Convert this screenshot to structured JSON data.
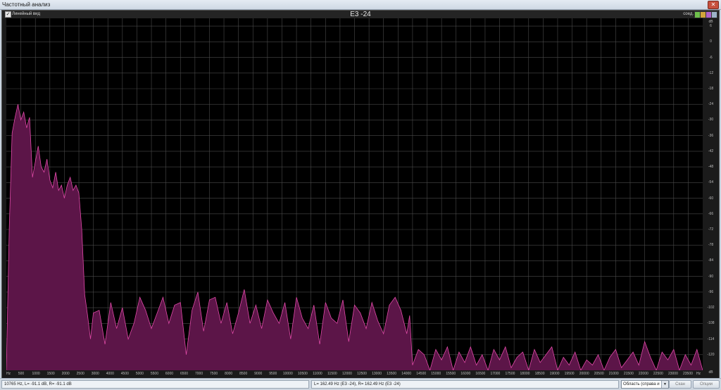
{
  "window": {
    "title": "Частотный анализ",
    "close_glyph": "✕"
  },
  "toolbar": {
    "checkbox_label": "Линейный вид",
    "checkbox_checked": true,
    "check_glyph": "✓",
    "title": "E3 -24",
    "right_label": "соед."
  },
  "colors": {
    "spectrum_fill": "#5c1548",
    "spectrum_stroke": "#e04aa8",
    "grid": "#4a4a4a",
    "accent_buttons": [
      "#6fbf4b",
      "#d1a53a",
      "#b061c8",
      "#9cb2c8"
    ]
  },
  "y_axis": {
    "unit_top": "dB",
    "unit_bottom": "dB",
    "ticks": [
      "6",
      "0",
      "-6",
      "-12",
      "-18",
      "-24",
      "-30",
      "-36",
      "-42",
      "-48",
      "-54",
      "-60",
      "-66",
      "-72",
      "-78",
      "-84",
      "-90",
      "-96",
      "-102",
      "-108",
      "-114",
      "-120"
    ]
  },
  "x_axis": {
    "left_label": "Hz",
    "right_label": "Hz",
    "ticks": [
      "500",
      "1000",
      "1500",
      "2000",
      "2500",
      "3000",
      "4000",
      "4500",
      "5000",
      "5500",
      "6000",
      "6500",
      "7000",
      "7500",
      "8000",
      "8500",
      "9000",
      "9500",
      "10000",
      "10500",
      "11000",
      "11500",
      "12000",
      "12500",
      "13000",
      "13500",
      "14000",
      "14500",
      "15000",
      "15500",
      "16000",
      "16500",
      "17000",
      "17500",
      "18000",
      "18500",
      "19000",
      "19500",
      "20000",
      "20500",
      "21000",
      "21500",
      "22000",
      "22500",
      "23000",
      "23500"
    ]
  },
  "chart_data": {
    "type": "area",
    "title": "E3 -24",
    "xlabel": "Hz",
    "ylabel": "dB",
    "xlim": [
      0,
      24000
    ],
    "ylim": [
      -126,
      9
    ],
    "x": [
      0,
      100,
      200,
      300,
      400,
      500,
      600,
      700,
      800,
      900,
      1000,
      1100,
      1200,
      1300,
      1400,
      1500,
      1600,
      1700,
      1800,
      1900,
      2000,
      2100,
      2200,
      2300,
      2400,
      2500,
      2600,
      2700,
      2800,
      2900,
      3000,
      3200,
      3400,
      3600,
      3800,
      4000,
      4200,
      4400,
      4600,
      4800,
      5000,
      5200,
      5400,
      5600,
      5800,
      6000,
      6200,
      6400,
      6600,
      6800,
      7000,
      7200,
      7400,
      7600,
      7800,
      8000,
      8200,
      8400,
      8600,
      8800,
      9000,
      9200,
      9400,
      9600,
      9800,
      10000,
      10200,
      10400,
      10600,
      10800,
      11000,
      11200,
      11400,
      11600,
      11800,
      12000,
      12200,
      12400,
      12600,
      12800,
      13000,
      13200,
      13400,
      13600,
      13800,
      13900,
      14000,
      14200,
      14400,
      14600,
      14800,
      15000,
      15200,
      15400,
      15600,
      15800,
      16000,
      16200,
      16400,
      16600,
      16800,
      17000,
      17200,
      17400,
      17600,
      17800,
      18000,
      18200,
      18400,
      18600,
      18800,
      19000,
      19200,
      19400,
      19600,
      19800,
      20000,
      20200,
      20400,
      20600,
      20800,
      21000,
      21200,
      21400,
      21600,
      21800,
      22000,
      22200,
      22400,
      22600,
      22800,
      23000,
      23200,
      23400,
      23600,
      23800,
      24000
    ],
    "values": [
      -126,
      -72,
      -35,
      -29,
      -24,
      -30,
      -27,
      -33,
      -29,
      -52,
      -46,
      -40,
      -48,
      -50,
      -45,
      -53,
      -56,
      -50,
      -57,
      -55,
      -60,
      -55,
      -52,
      -57,
      -55,
      -58,
      -72,
      -97,
      -105,
      -114,
      -104,
      -103,
      -116,
      -100,
      -110,
      -102,
      -114,
      -108,
      -98,
      -103,
      -110,
      -104,
      -98,
      -108,
      -101,
      -100,
      -120,
      -103,
      -96,
      -111,
      -99,
      -98,
      -108,
      -100,
      -112,
      -104,
      -95,
      -108,
      -101,
      -110,
      -99,
      -104,
      -108,
      -100,
      -114,
      -98,
      -106,
      -110,
      -101,
      -116,
      -100,
      -106,
      -108,
      -99,
      -115,
      -101,
      -104,
      -110,
      -100,
      -107,
      -112,
      -101,
      -98,
      -103,
      -112,
      -105,
      -124,
      -118,
      -120,
      -126,
      -118,
      -122,
      -117,
      -126,
      -119,
      -123,
      -117,
      -124,
      -120,
      -126,
      -118,
      -122,
      -117,
      -125,
      -121,
      -119,
      -126,
      -118,
      -123,
      -120,
      -117,
      -126,
      -121,
      -124,
      -119,
      -126,
      -122,
      -124,
      -120,
      -126,
      -121,
      -118,
      -125,
      -122,
      -119,
      -124,
      -115,
      -121,
      -126,
      -119,
      -122,
      -118,
      -126,
      -120,
      -124,
      -118,
      -126
    ]
  },
  "status": {
    "left": "10765 Hz, L= -91.1 dB, R= -91.1 dB",
    "middle": "L= 162.49 Hz (E3 -24), R= 162.49 Hz (E3 -24)",
    "select_value": "Область (справа и",
    "select_arrow": "▼",
    "scan_button": "Скан",
    "options_button": "Опции"
  }
}
